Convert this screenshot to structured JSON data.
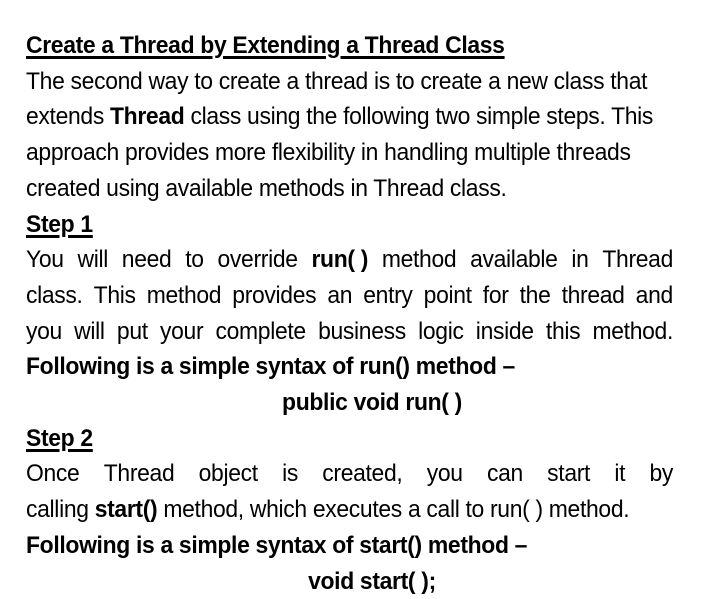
{
  "document": {
    "title": "Create a Thread by Extending a Thread Class",
    "background_color": "#ffffff",
    "text_color": "#000000"
  },
  "heading": {
    "main": "Create a Thread by Extending a Thread Class",
    "step1": "Step 1",
    "step2": "Step 2"
  },
  "intro_paragraph": {
    "line1": "The second way to create a thread is to create a new class that",
    "line2_a": "extends ",
    "line2_b": "Thread",
    "line2_c": " class using the following two simple steps. This",
    "line3": "approach provides more flexibility in handling multiple threads",
    "line4": "created using available methods in Thread class."
  },
  "step1_paragraph": {
    "line1_w1": "You",
    "line1_w2": "will",
    "line1_w3": "need",
    "line1_w4": "to",
    "line1_w5": "override",
    "line1_w6": "run( )",
    "line1_w7": "method",
    "line1_w8": "available",
    "line1_w9": "in",
    "line1_w10": "Thread",
    "line2_w1": "class.",
    "line2_w2": "This",
    "line2_w3": "method",
    "line2_w4": "provides",
    "line2_w5": "an",
    "line2_w6": "entry",
    "line2_w7": "point",
    "line2_w8": "for",
    "line2_w9": "the",
    "line2_w10": "thread",
    "line2_w11": "and",
    "line3_w1": "you",
    "line3_w2": "will",
    "line3_w3": "put",
    "line3_w4": "your",
    "line3_w5": "complete",
    "line3_w6": "business",
    "line3_w7": "logic",
    "line3_w8": "inside",
    "line3_w9": "this",
    "line3_w10": "method."
  },
  "run_syntax": {
    "intro": "Following is a simple syntax of run() method –",
    "code": "public void run( )"
  },
  "step2_paragraph": {
    "line1_w1": "Once",
    "line1_w2": "Thread",
    "line1_w3": "object",
    "line1_w4": "is",
    "line1_w5": "created,",
    "line1_w6": "you",
    "line1_w7": "can",
    "line1_w8": "start",
    "line1_w9": "it",
    "line1_w10": "by",
    "line2_a": "calling ",
    "line2_b": "start()",
    "line2_c": " method, which executes a call to run( ) method."
  },
  "start_syntax": {
    "intro": "Following is a simple syntax of start() method –",
    "code": "void start( );"
  }
}
